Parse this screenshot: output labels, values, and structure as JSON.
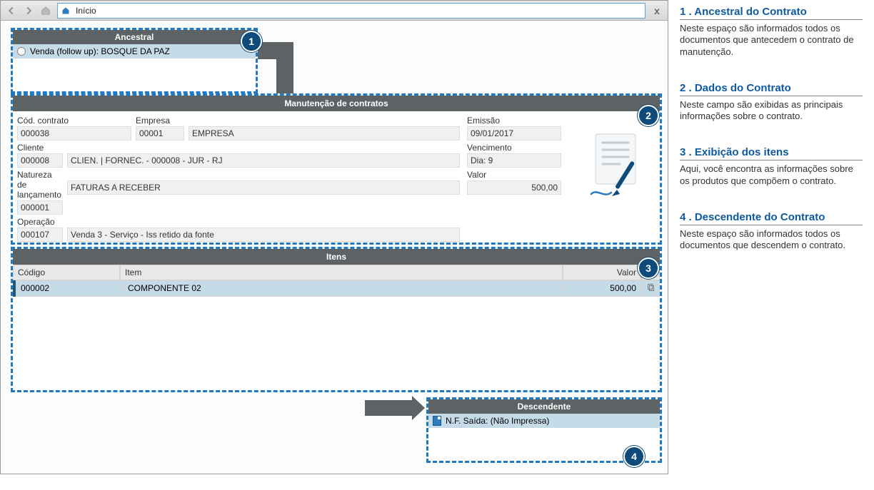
{
  "toolbar": {
    "title": "Início"
  },
  "ancestral": {
    "header": "Ancestral",
    "item": "Venda (follow up): BOSQUE DA PAZ"
  },
  "contract": {
    "header": "Manutenção de contratos",
    "fields": {
      "cod_contrato_label": "Cód. contrato",
      "cod_contrato": "000038",
      "empresa_label": "Empresa",
      "empresa_code": "00001",
      "empresa_name": "EMPRESA",
      "emissao_label": "Emissão",
      "emissao": "09/01/2017",
      "cliente_label": "Cliente",
      "cliente_code": "000008",
      "cliente_name": "CLIEN. | FORNEC. - 000008 - JUR - RJ",
      "vencimento_label": "Vencimento",
      "vencimento": "Dia: 9",
      "natureza_label": "Natureza de lançamento",
      "natureza_code": "000001",
      "natureza_desc": "FATURAS A RECEBER",
      "valor_label": "Valor",
      "valor": "500,00",
      "operacao_label": "Operação",
      "operacao_code": "000107",
      "operacao_desc": "Venda 3 - Serviço - Iss retido da fonte"
    }
  },
  "itens": {
    "header": "Itens",
    "columns": {
      "codigo": "Código",
      "item": "Item",
      "valor": "Valor"
    },
    "rows": [
      {
        "codigo": "000002",
        "item": "COMPONENTE 02",
        "valor": "500,00"
      }
    ]
  },
  "descendente": {
    "header": "Descendente",
    "item": "N.F. Saída: (Não Impressa)"
  },
  "badges": {
    "b1": "1",
    "b2": "2",
    "b3": "3",
    "b4": "4"
  },
  "notes": {
    "n1_title": "1 . Ancestral do Contrato",
    "n1_text": "Neste espaço são informados todos os documentos que antecedem o contrato de manutenção.",
    "n2_title": "2 . Dados do Contrato",
    "n2_text": "Neste campo são exibidas as principais informações sobre o contrato.",
    "n3_title": "3 . Exibição dos itens",
    "n3_text": "Aqui, você encontra as informações sobre os produtos que compõem o contrato.",
    "n4_title": "4 . Descendente do Contrato",
    "n4_text": "Neste espaço são informados todos os documentos que descendem o contrato."
  }
}
